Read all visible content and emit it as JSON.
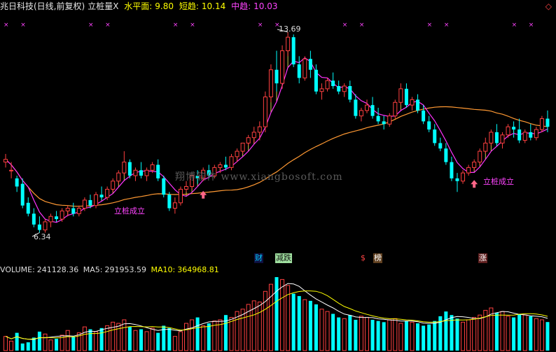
{
  "header": {
    "stock_name": "兆日科技(日线,前复权)",
    "indicator": "立桩量X",
    "flat_label": "水平面:",
    "flat_value": "9.80",
    "short_label": "短趋:",
    "short_value": "10.14",
    "mid_label": "中趋:",
    "mid_value": "10.03"
  },
  "volume_header": {
    "volume_label": "VOLUME:",
    "volume_value": "241128.36",
    "ma5_label": "MA5:",
    "ma5_value": "291953.59",
    "ma10_label": "MA10:",
    "ma10_value": "364968.81"
  },
  "watermark": "翔博软件 www.xiangbosoft.com",
  "signals": {
    "signal_1": "立桩成立",
    "signal_2": "立桩成立"
  },
  "price_labels": {
    "high": "13.69",
    "low": "6.34"
  },
  "tags": [
    "财",
    "减跌",
    "$",
    "榜",
    "涨"
  ],
  "colors": {
    "up": "#ff4040",
    "down": "#00ffff",
    "ma_short": "#ff33ff",
    "ma_long": "#ff9933",
    "fill": "#ffff66",
    "background": "#000000"
  },
  "chart_data": {
    "type": "candlestick",
    "price_range": [
      5.9,
      14.2
    ],
    "candles": [
      [
        8.9,
        9.2,
        9.0,
        8.7
      ],
      [
        8.6,
        8.9,
        8.6,
        8.3
      ],
      [
        8.3,
        8.4,
        8.0,
        7.8
      ],
      [
        8.1,
        8.3,
        7.3,
        7.2
      ],
      [
        7.4,
        7.6,
        7.0,
        6.9
      ],
      [
        7.0,
        7.2,
        6.6,
        6.5
      ],
      [
        6.6,
        6.9,
        6.4,
        6.3
      ],
      [
        6.4,
        6.8,
        6.7,
        6.3
      ],
      [
        6.7,
        7.0,
        6.9,
        6.5
      ],
      [
        6.9,
        7.1,
        6.8,
        6.7
      ],
      [
        6.8,
        7.2,
        7.1,
        6.7
      ],
      [
        7.1,
        7.3,
        7.2,
        6.9
      ],
      [
        7.2,
        7.4,
        7.0,
        6.9
      ],
      [
        7.0,
        7.3,
        7.2,
        6.9
      ],
      [
        7.2,
        7.6,
        7.5,
        7.1
      ],
      [
        7.5,
        7.7,
        7.3,
        7.2
      ],
      [
        7.3,
        7.8,
        7.7,
        7.2
      ],
      [
        7.7,
        8.0,
        7.6,
        7.5
      ],
      [
        7.6,
        8.0,
        7.9,
        7.5
      ],
      [
        7.9,
        8.3,
        8.2,
        7.8
      ],
      [
        8.2,
        8.6,
        8.5,
        8.1
      ],
      [
        8.5,
        9.3,
        8.9,
        8.4
      ],
      [
        8.9,
        9.0,
        8.4,
        8.3
      ],
      [
        8.4,
        8.7,
        8.6,
        8.2
      ],
      [
        8.6,
        8.9,
        8.4,
        8.3
      ],
      [
        8.4,
        8.7,
        8.6,
        8.2
      ],
      [
        8.6,
        8.9,
        8.8,
        8.5
      ],
      [
        8.8,
        9.0,
        8.3,
        8.2
      ],
      [
        8.3,
        8.4,
        7.7,
        7.6
      ],
      [
        7.7,
        7.8,
        7.2,
        7.1
      ],
      [
        7.2,
        7.6,
        7.4,
        7.0
      ],
      [
        7.4,
        8.0,
        7.9,
        7.3
      ],
      [
        7.9,
        8.2,
        8.0,
        7.8
      ],
      [
        8.0,
        8.5,
        8.4,
        7.9
      ],
      [
        8.4,
        8.6,
        8.3,
        8.1
      ],
      [
        8.3,
        8.7,
        8.6,
        8.2
      ],
      [
        8.6,
        8.8,
        8.4,
        8.3
      ],
      [
        8.4,
        8.8,
        8.7,
        8.3
      ],
      [
        8.7,
        8.9,
        8.8,
        8.5
      ],
      [
        8.8,
        9.1,
        8.7,
        8.6
      ],
      [
        8.7,
        9.2,
        9.1,
        8.6
      ],
      [
        9.1,
        9.4,
        9.3,
        8.9
      ],
      [
        9.3,
        9.6,
        9.6,
        9.2
      ],
      [
        9.6,
        9.9,
        9.8,
        9.5
      ],
      [
        9.8,
        10.2,
        10.0,
        9.6
      ],
      [
        10.0,
        10.4,
        10.2,
        9.7
      ],
      [
        10.2,
        11.5,
        11.3,
        10.0
      ],
      [
        11.3,
        12.5,
        12.3,
        11.1
      ],
      [
        12.3,
        13.0,
        11.8,
        11.5
      ],
      [
        11.8,
        13.2,
        13.0,
        11.6
      ],
      [
        13.0,
        13.69,
        13.5,
        12.8
      ],
      [
        13.5,
        13.6,
        12.5,
        12.4
      ],
      [
        12.5,
        12.8,
        12.0,
        11.8
      ],
      [
        12.0,
        12.8,
        12.7,
        11.9
      ],
      [
        12.7,
        13.0,
        12.3,
        12.0
      ],
      [
        12.3,
        12.5,
        11.5,
        11.4
      ],
      [
        11.5,
        11.8,
        11.6,
        11.2
      ],
      [
        11.6,
        12.0,
        11.9,
        11.5
      ],
      [
        11.9,
        12.2,
        11.7,
        11.6
      ],
      [
        11.7,
        11.9,
        11.5,
        11.4
      ],
      [
        11.5,
        11.8,
        11.7,
        11.3
      ],
      [
        11.7,
        11.9,
        11.2,
        11.1
      ],
      [
        11.2,
        11.4,
        10.6,
        10.5
      ],
      [
        10.6,
        10.9,
        10.8,
        10.4
      ],
      [
        10.8,
        11.2,
        11.0,
        10.7
      ],
      [
        11.0,
        11.3,
        10.6,
        10.5
      ],
      [
        10.6,
        10.9,
        10.4,
        10.3
      ],
      [
        10.4,
        10.6,
        10.3,
        10.1
      ],
      [
        10.3,
        10.7,
        10.6,
        10.2
      ],
      [
        10.6,
        11.2,
        11.1,
        10.5
      ],
      [
        11.1,
        11.8,
        11.6,
        11.0
      ],
      [
        11.6,
        11.8,
        11.0,
        10.9
      ],
      [
        11.0,
        11.3,
        11.2,
        10.8
      ],
      [
        11.2,
        11.4,
        10.8,
        10.7
      ],
      [
        10.8,
        11.0,
        10.4,
        10.3
      ],
      [
        10.4,
        10.6,
        10.1,
        10.0
      ],
      [
        10.1,
        10.3,
        9.6,
        9.5
      ],
      [
        9.6,
        9.8,
        9.4,
        9.3
      ],
      [
        9.4,
        9.6,
        8.9,
        8.8
      ],
      [
        8.9,
        9.1,
        8.3,
        8.2
      ],
      [
        8.3,
        8.5,
        8.2,
        7.8
      ],
      [
        8.2,
        8.6,
        8.5,
        8.1
      ],
      [
        8.5,
        8.8,
        8.7,
        8.4
      ],
      [
        8.7,
        9.0,
        8.9,
        8.6
      ],
      [
        8.9,
        9.4,
        9.3,
        8.8
      ],
      [
        9.3,
        9.8,
        9.6,
        9.2
      ],
      [
        9.6,
        10.1,
        10.0,
        9.5
      ],
      [
        10.0,
        10.3,
        9.6,
        9.5
      ],
      [
        9.6,
        10.0,
        9.9,
        9.4
      ],
      [
        9.9,
        10.3,
        10.2,
        9.8
      ],
      [
        10.2,
        10.4,
        10.1,
        9.8
      ],
      [
        10.1,
        10.5,
        9.7,
        9.6
      ],
      [
        9.7,
        10.1,
        10.0,
        9.6
      ],
      [
        10.0,
        10.3,
        9.8,
        9.7
      ],
      [
        9.8,
        10.2,
        10.1,
        9.7
      ],
      [
        10.1,
        10.6,
        10.5,
        10.0
      ],
      [
        10.5,
        10.8,
        10.2,
        10.0
      ]
    ],
    "volume": [
      120,
      80,
      150,
      60,
      70,
      110,
      160,
      140,
      90,
      100,
      130,
      170,
      120,
      150,
      200,
      180,
      160,
      190,
      210,
      240,
      230,
      260,
      200,
      170,
      180,
      160,
      190,
      150,
      210,
      190,
      120,
      160,
      230,
      260,
      280,
      210,
      230,
      250,
      260,
      300,
      280,
      330,
      350,
      390,
      420,
      410,
      500,
      560,
      620,
      600,
      550,
      480,
      460,
      430,
      420,
      390,
      350,
      330,
      310,
      280,
      270,
      300,
      260,
      290,
      280,
      260,
      250,
      240,
      260,
      270,
      230,
      250,
      240,
      230,
      210,
      220,
      250,
      290,
      330,
      300,
      270,
      240,
      260,
      280,
      300,
      340,
      360,
      320,
      330,
      290,
      280,
      310,
      300,
      290,
      270,
      260,
      241
    ],
    "volume_max": 620,
    "tags": [
      "财",
      "减跌",
      "$",
      "榜",
      "涨"
    ]
  }
}
